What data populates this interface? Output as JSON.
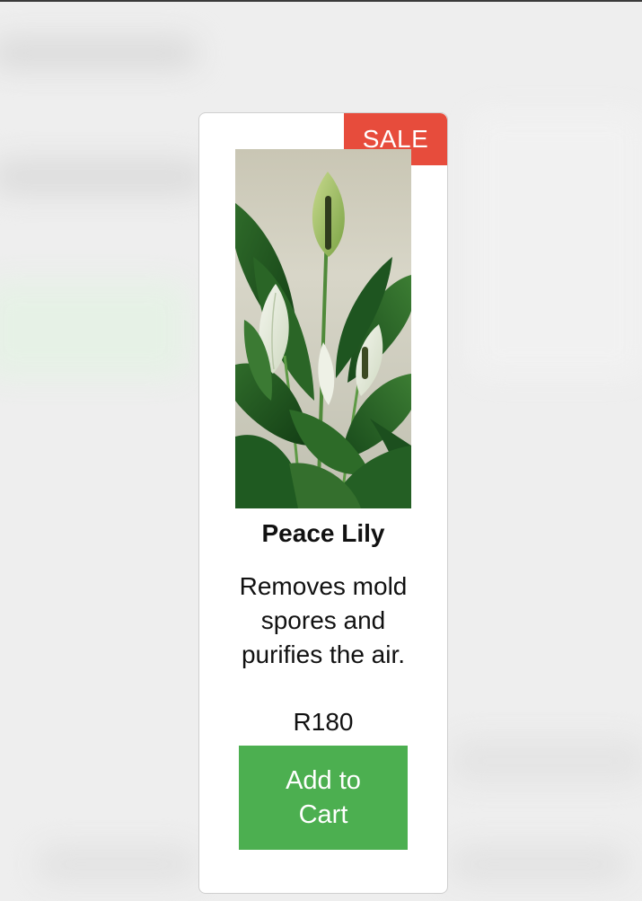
{
  "product": {
    "badge": "SALE",
    "name": "Peace Lily",
    "description": "Removes mold spores and purifies the air.",
    "price": "R180",
    "image_icon": "peace-lily-photo",
    "add_to_cart_label": "Add to Cart"
  },
  "colors": {
    "badge": "#e74c3c",
    "button": "#4caf50",
    "card": "#ffffff",
    "backdrop": "#ebebeb"
  }
}
